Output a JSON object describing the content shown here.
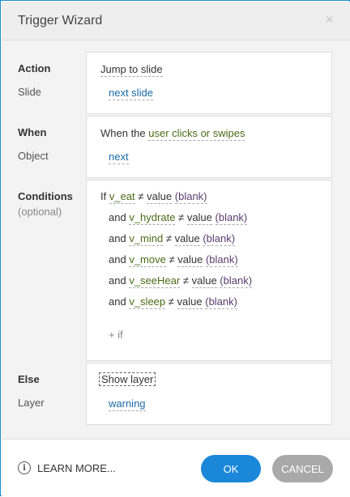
{
  "window": {
    "title": "Trigger Wizard",
    "close": "×"
  },
  "action": {
    "label": "Action",
    "value": "Jump to slide",
    "sub_label": "Slide",
    "sub_value": "next slide"
  },
  "when": {
    "label": "When",
    "prefix": "When the",
    "value": "user clicks or swipes",
    "sub_label": "Object",
    "sub_value": "next"
  },
  "conditions": {
    "label": "Conditions",
    "sub_label": "(optional)",
    "rows": [
      {
        "connector": "If",
        "variable": "v_eat",
        "op": "≠",
        "compare": "value",
        "value": "(blank)"
      },
      {
        "connector": "and",
        "variable": "v_hydrate",
        "op": "≠",
        "compare": "value",
        "value": "(blank)"
      },
      {
        "connector": "and",
        "variable": "v_mind",
        "op": "≠",
        "compare": "value",
        "value": "(blank)"
      },
      {
        "connector": "and",
        "variable": "v_move",
        "op": "≠",
        "compare": "value",
        "value": "(blank)"
      },
      {
        "connector": "and",
        "variable": "v_seeHear",
        "op": "≠",
        "compare": "value",
        "value": "(blank)"
      },
      {
        "connector": "and",
        "variable": "v_sleep",
        "op": "≠",
        "compare": "value",
        "value": "(blank)"
      }
    ],
    "add_if": "+ if"
  },
  "else": {
    "label": "Else",
    "value": "Show layer",
    "sub_label": "Layer",
    "sub_value": "warning"
  },
  "footer": {
    "learn_more": "LEARN MORE...",
    "info_icon": "i",
    "ok": "OK",
    "cancel": "CANCEL"
  }
}
